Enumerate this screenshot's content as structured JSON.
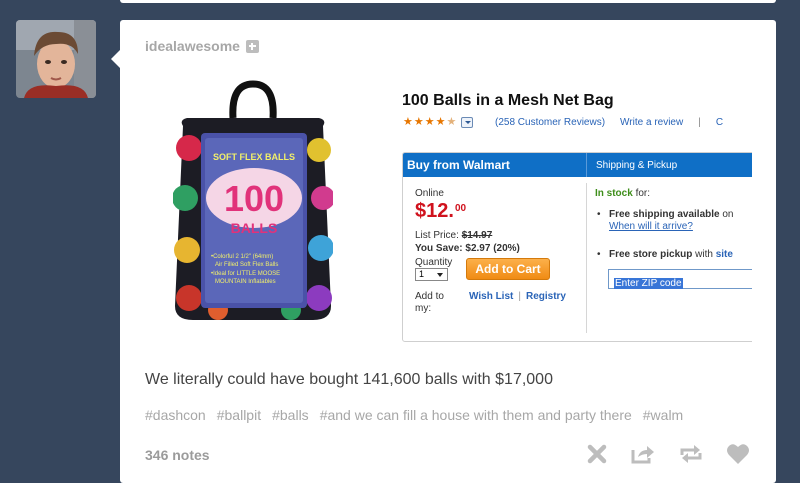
{
  "post": {
    "blog_name": "idealawesome",
    "caption": "We literally could have bought 141,600 balls with $17,000",
    "tags": [
      "#dashcon",
      "#ballpit",
      "#balls",
      "#and we can fill a house with them and party there",
      "#walm"
    ],
    "notes": "346 notes"
  },
  "product": {
    "title": "100 Balls in a Mesh Net Bag",
    "rating_stars": 4.5,
    "reviews_link": "(258 Customer Reviews)",
    "write_review": "Write a review",
    "divider": "|",
    "cut_char": "C",
    "bag_label": {
      "brand": "SOFT FLEX BALLS",
      "big": "100",
      "word": "BALLS",
      "line1": "•Colorful 2 1/2\" (64mm)",
      "line2": "Air Filled Soft Flex Balls",
      "line3": "•Ideal for LITTLE MOOSE",
      "line4": "MOUNTAIN Inflatables"
    }
  },
  "buybox": {
    "title": "Buy from Walmart",
    "shipping_tab": "Shipping & Pickup",
    "online": "Online",
    "price_dollars": "$12.",
    "price_cents": "00",
    "list_price_label": "List Price:",
    "list_price": "$14.97",
    "you_save": "You Save: $2.97 (20%)",
    "quantity_label": "Quantity",
    "quantity_value": "1",
    "add_to_cart": "Add to Cart",
    "add_to_my": "Add to my:",
    "wish_list": "Wish List",
    "separator": "|",
    "registry": "Registry",
    "in_stock": "In stock",
    "in_stock_suffix": " for:",
    "free_shipping": "Free shipping available",
    "free_shipping_on": " on",
    "when_arrive": "When will it arrive?",
    "free_pickup": "Free store pickup",
    "with": " with ",
    "site": "site",
    "zip_placeholder": "Enter ZIP code"
  },
  "colors": {
    "background": "#36465d",
    "walmart_blue": "#0f6fc6",
    "price_red": "#d0121d",
    "cart_orange": "#f08b14",
    "stock_green": "#3e8e1a",
    "icon_gray": "#bdbdbd"
  },
  "icons": {
    "follow": "plus-square-icon",
    "delete": "x-icon",
    "share": "share-icon",
    "reblog": "reblog-icon",
    "like": "heart-icon"
  }
}
